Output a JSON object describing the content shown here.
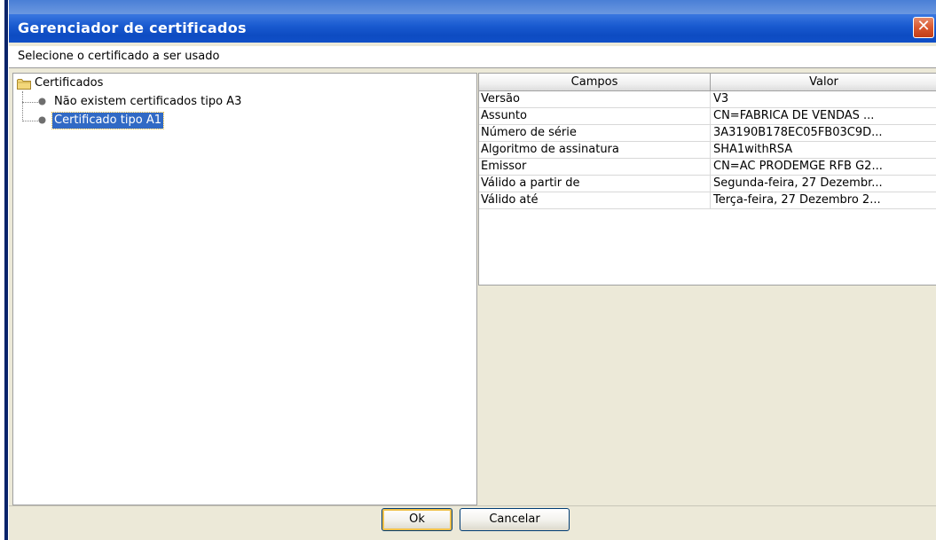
{
  "window": {
    "title": "Gerenciador de certificados",
    "close_glyph": "✕",
    "subtitle": "Selecione o certificado a ser usado"
  },
  "tree": {
    "root_label": "Certificados",
    "root_icon": "folder-icon",
    "items": [
      {
        "label": "Não existem certificados tipo A3",
        "selected": false,
        "icon": "node-bullet-icon"
      },
      {
        "label": "Certificado tipo A1",
        "selected": true,
        "icon": "node-bullet-icon"
      }
    ]
  },
  "table": {
    "headers": {
      "campos": "Campos",
      "valor": "Valor"
    },
    "rows": [
      {
        "campo": "Versão",
        "valor": "V3"
      },
      {
        "campo": "Assunto",
        "valor": "CN=FABRICA DE VENDAS ..."
      },
      {
        "campo": "Número de série",
        "valor": "3A3190B178EC05FB03C9D..."
      },
      {
        "campo": "Algoritmo de assinatura",
        "valor": "SHA1withRSA"
      },
      {
        "campo": "Emissor",
        "valor": "CN=AC PRODEMGE RFB G2..."
      },
      {
        "campo": "Válido a partir de",
        "valor": "Segunda-feira, 27 Dezembr..."
      },
      {
        "campo": "Válido até",
        "valor": "Terça-feira, 27 Dezembro 2..."
      }
    ]
  },
  "buttons": {
    "ok_label": "Ok",
    "cancel_label": "Cancelar"
  },
  "colors": {
    "titlebar": "#0d4bc2",
    "selection": "#316ac5",
    "close_button": "#d9582f",
    "dialog_background": "#ece9d8"
  }
}
